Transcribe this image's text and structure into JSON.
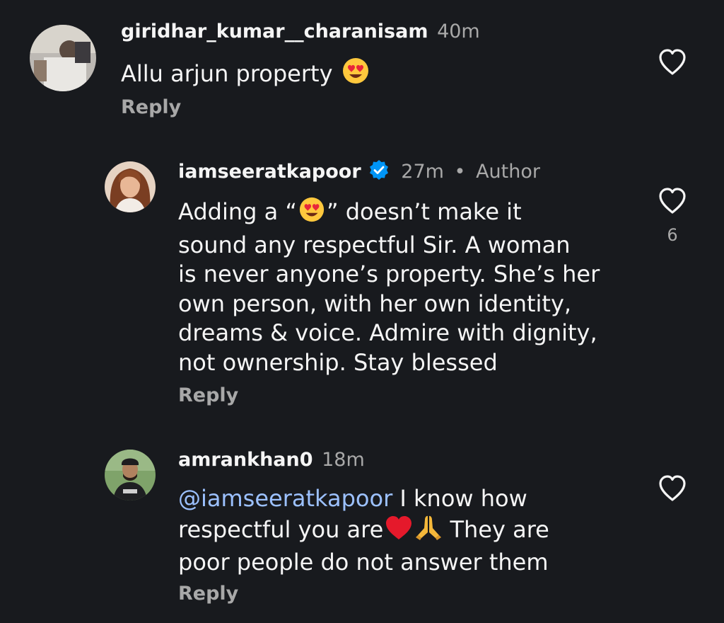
{
  "comments": [
    {
      "username": "giridhar_kumar__charanisam",
      "time": "40m",
      "text": "Allu arjun property",
      "emoji": "heart-eyes",
      "reply_label": "Reply",
      "avatar": "user-photo-avatar"
    },
    {
      "username": "iamseeratkapoor",
      "verified": true,
      "time": "27m",
      "separator": "•",
      "author_label": "Author",
      "lines": [
        {
          "before": "Adding a “",
          "emoji": "heart-eyes",
          "after": "” doesn’t make it"
        },
        {
          "text": "sound any respectful Sir. A woman"
        },
        {
          "text": "is never anyone’s property. She’s her"
        },
        {
          "text": "own person, with her own identity,"
        },
        {
          "text": "dreams & voice. Admire with dignity,"
        },
        {
          "text": "not ownership. Stay blessed"
        }
      ],
      "like_count": "6",
      "reply_label": "Reply",
      "avatar": "woman-portrait-avatar"
    },
    {
      "username": "amrankhan0",
      "time": "18m",
      "mention": "@iamseeratkapoor",
      "line1_rest": " I know how",
      "line2": "respectful you are",
      "line2_emojis": [
        "red-heart",
        "folded-hands"
      ],
      "line2_rest": " They are",
      "line3": "poor people do not answer them",
      "reply_label": "Reply",
      "avatar": "man-portrait-avatar"
    }
  ],
  "colors": {
    "background": "#181a1e",
    "text_primary": "#f5f5f5",
    "text_secondary": "#a8a8a8",
    "mention": "#9cc1ff",
    "verified": "#0095f6"
  }
}
